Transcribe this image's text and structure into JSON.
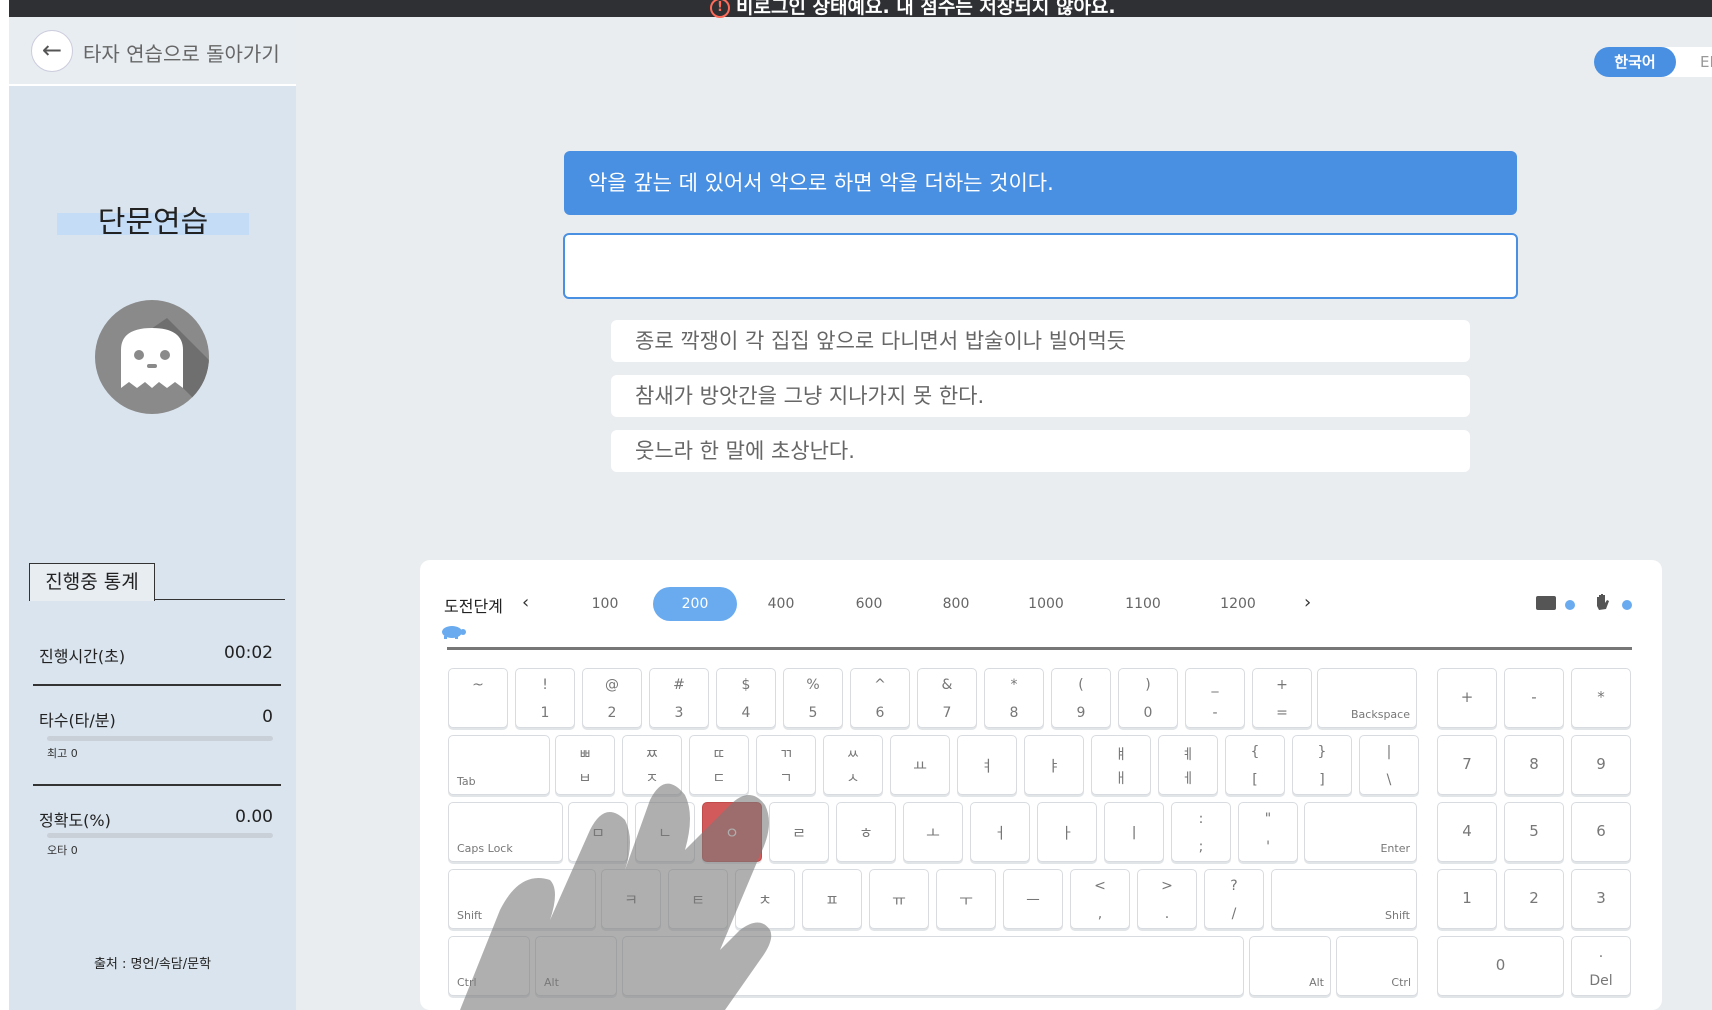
{
  "notice": {
    "text": "비로그인 상태예요. 내 점수는 저장되지 않아요."
  },
  "sidebar": {
    "back_label": "타자 연습으로 돌아가기",
    "mode_title": "단문연습",
    "stats_tab": "진행중 통계",
    "stats": {
      "time_label": "진행시간(초)",
      "time_value": "00:02",
      "speed_label": "타수(타/분)",
      "speed_value": "0",
      "speed_best": "최고 0",
      "speed_fill": 0,
      "acc_label": "정확도(%)",
      "acc_value": "0.00",
      "acc_typo": "오타 0",
      "acc_fill": 0
    },
    "source": "출처 : 명언/속담/문학"
  },
  "lang": {
    "ko": "한국어",
    "en": "EI"
  },
  "practice": {
    "target": "악을 갚는 데 있어서 악으로 하면 악을 더하는 것이다.",
    "input_value": "",
    "next": [
      "종로 깍쟁이 각 집집 앞으로 다니면서 밥술이나 빌어먹듯",
      "참새가 방앗간을 그냥 지나가지 못 한다.",
      "웃느라 한 말에 초상난다."
    ]
  },
  "levels": {
    "label": "도전단계",
    "items": [
      "100",
      "200",
      "400",
      "600",
      "800",
      "1000",
      "1100",
      "1200"
    ],
    "selected": "200"
  },
  "keyboard": {
    "row1": [
      [
        "~",
        ""
      ],
      [
        "!",
        "1"
      ],
      [
        "@",
        "2"
      ],
      [
        "#",
        "3"
      ],
      [
        "$",
        "4"
      ],
      [
        "%",
        "5"
      ],
      [
        "^",
        "6"
      ],
      [
        "&",
        "7"
      ],
      [
        "*",
        "8"
      ],
      [
        "(",
        "9"
      ],
      [
        ")",
        "0"
      ],
      [
        "_",
        "-"
      ],
      [
        "+",
        "="
      ]
    ],
    "backspace": "Backspace",
    "tab": "Tab",
    "row2": [
      [
        "ㅃ",
        "ㅂ"
      ],
      [
        "ㅉ",
        "ㅈ"
      ],
      [
        "ㄸ",
        "ㄷ"
      ],
      [
        "ㄲ",
        "ㄱ"
      ],
      [
        "ㅆ",
        "ㅅ"
      ],
      [
        "",
        "ㅛ"
      ],
      [
        "",
        "ㅕ"
      ],
      [
        "",
        "ㅑ"
      ],
      [
        "ㅒ",
        "ㅐ"
      ],
      [
        "ㅖ",
        "ㅔ"
      ],
      [
        "{",
        "["
      ],
      [
        "}",
        "]"
      ],
      [
        "|",
        "\\"
      ]
    ],
    "caps": "Caps Lock",
    "row3": [
      "ㅁ",
      "ㄴ",
      "ㅇ",
      "ㄹ",
      "ㅎ",
      "ㅗ",
      "ㅓ",
      "ㅏ",
      "ㅣ"
    ],
    "row3_extra": [
      [
        ":",
        ";"
      ],
      [
        "\"",
        "'"
      ]
    ],
    "enter": "Enter",
    "shift": "Shift",
    "row4": [
      "ㅋ",
      "ㅌ",
      "ㅊ",
      "ㅍ",
      "ㅠ",
      "ㅜ",
      "ㅡ"
    ],
    "row4_extra": [
      [
        "<",
        ","
      ],
      [
        ">",
        "."
      ],
      [
        "?",
        "/"
      ]
    ],
    "ctrl": "Ctrl",
    "alt": "Alt",
    "highlight": "ㅇ",
    "numpad": [
      "+",
      "-",
      "*",
      "7",
      "8",
      "9",
      "4",
      "5",
      "6",
      "1",
      "2",
      "3",
      "0"
    ],
    "numpad_dot": ".",
    "numpad_del": "Del"
  },
  "colors": {
    "accent": "#4a90e2",
    "highlight_key": "#d35a5a",
    "sidebar": "#dae4ee"
  }
}
